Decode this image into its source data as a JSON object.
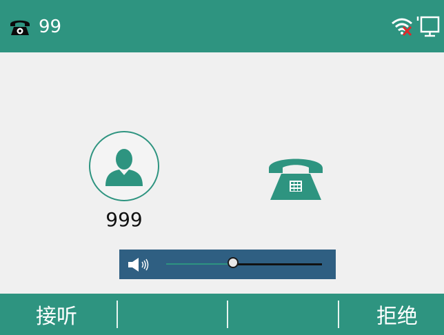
{
  "status_bar": {
    "account_label": "99",
    "phone_icon": "phone-icon",
    "wifi_icon": "wifi-disconnected-icon",
    "network_icon": "network-unavailable-icon",
    "bg_color": "#2e9480"
  },
  "call": {
    "caller_number": "999",
    "avatar_icon": "contact-avatar-icon",
    "ringing_icon": "incoming-call-phone-icon"
  },
  "volume": {
    "icon": "speaker-icon",
    "level": 0.4
  },
  "softkeys": {
    "key1": "接听",
    "key2": "",
    "key3": "",
    "key4": "拒绝"
  },
  "colors": {
    "accent": "#2e9480",
    "volume_bg": "#2f5f82"
  }
}
